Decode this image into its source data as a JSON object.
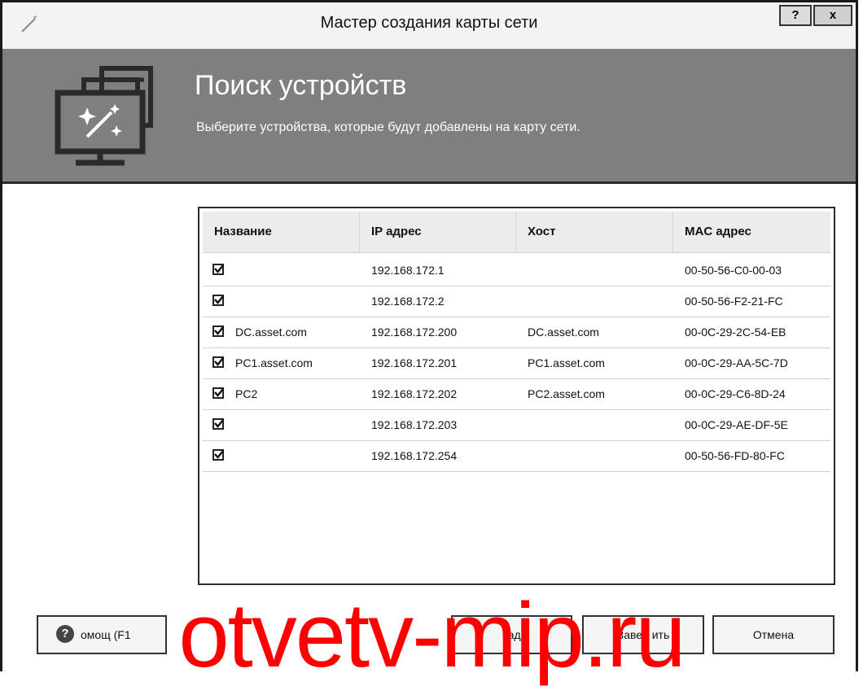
{
  "window": {
    "title": "Мастер создания карты сети",
    "help_button": "?",
    "close_button": "x"
  },
  "banner": {
    "title": "Поиск устройств",
    "subtitle": "Выберите устройства, которые будут добавлены на карту сети."
  },
  "table": {
    "columns": [
      "Название",
      "IP адрес",
      "Хост",
      "MAC адрес"
    ],
    "rows": [
      {
        "checked": true,
        "name": "",
        "ip": "192.168.172.1",
        "host": "",
        "mac": "00-50-56-C0-00-03"
      },
      {
        "checked": true,
        "name": "",
        "ip": "192.168.172.2",
        "host": "",
        "mac": "00-50-56-F2-21-FC"
      },
      {
        "checked": true,
        "name": "DC.asset.com",
        "ip": "192.168.172.200",
        "host": "DC.asset.com",
        "mac": "00-0C-29-2C-54-EB"
      },
      {
        "checked": true,
        "name": "PC1.asset.com",
        "ip": "192.168.172.201",
        "host": "PC1.asset.com",
        "mac": "00-0C-29-AA-5C-7D"
      },
      {
        "checked": true,
        "name": "PC2",
        "ip": "192.168.172.202",
        "host": "PC2.asset.com",
        "mac": "00-0C-29-C6-8D-24"
      },
      {
        "checked": true,
        "name": "",
        "ip": "192.168.172.203",
        "host": "",
        "mac": "00-0C-29-AE-DF-5E"
      },
      {
        "checked": true,
        "name": "",
        "ip": "192.168.172.254",
        "host": "",
        "mac": "00-50-56-FD-80-FC"
      }
    ]
  },
  "footer": {
    "help_label": "омощ (F1",
    "back_label": "зад",
    "finish_label": "Завер ить",
    "cancel_label": "Отмена"
  },
  "watermark": "otvetv-mip.ru"
}
